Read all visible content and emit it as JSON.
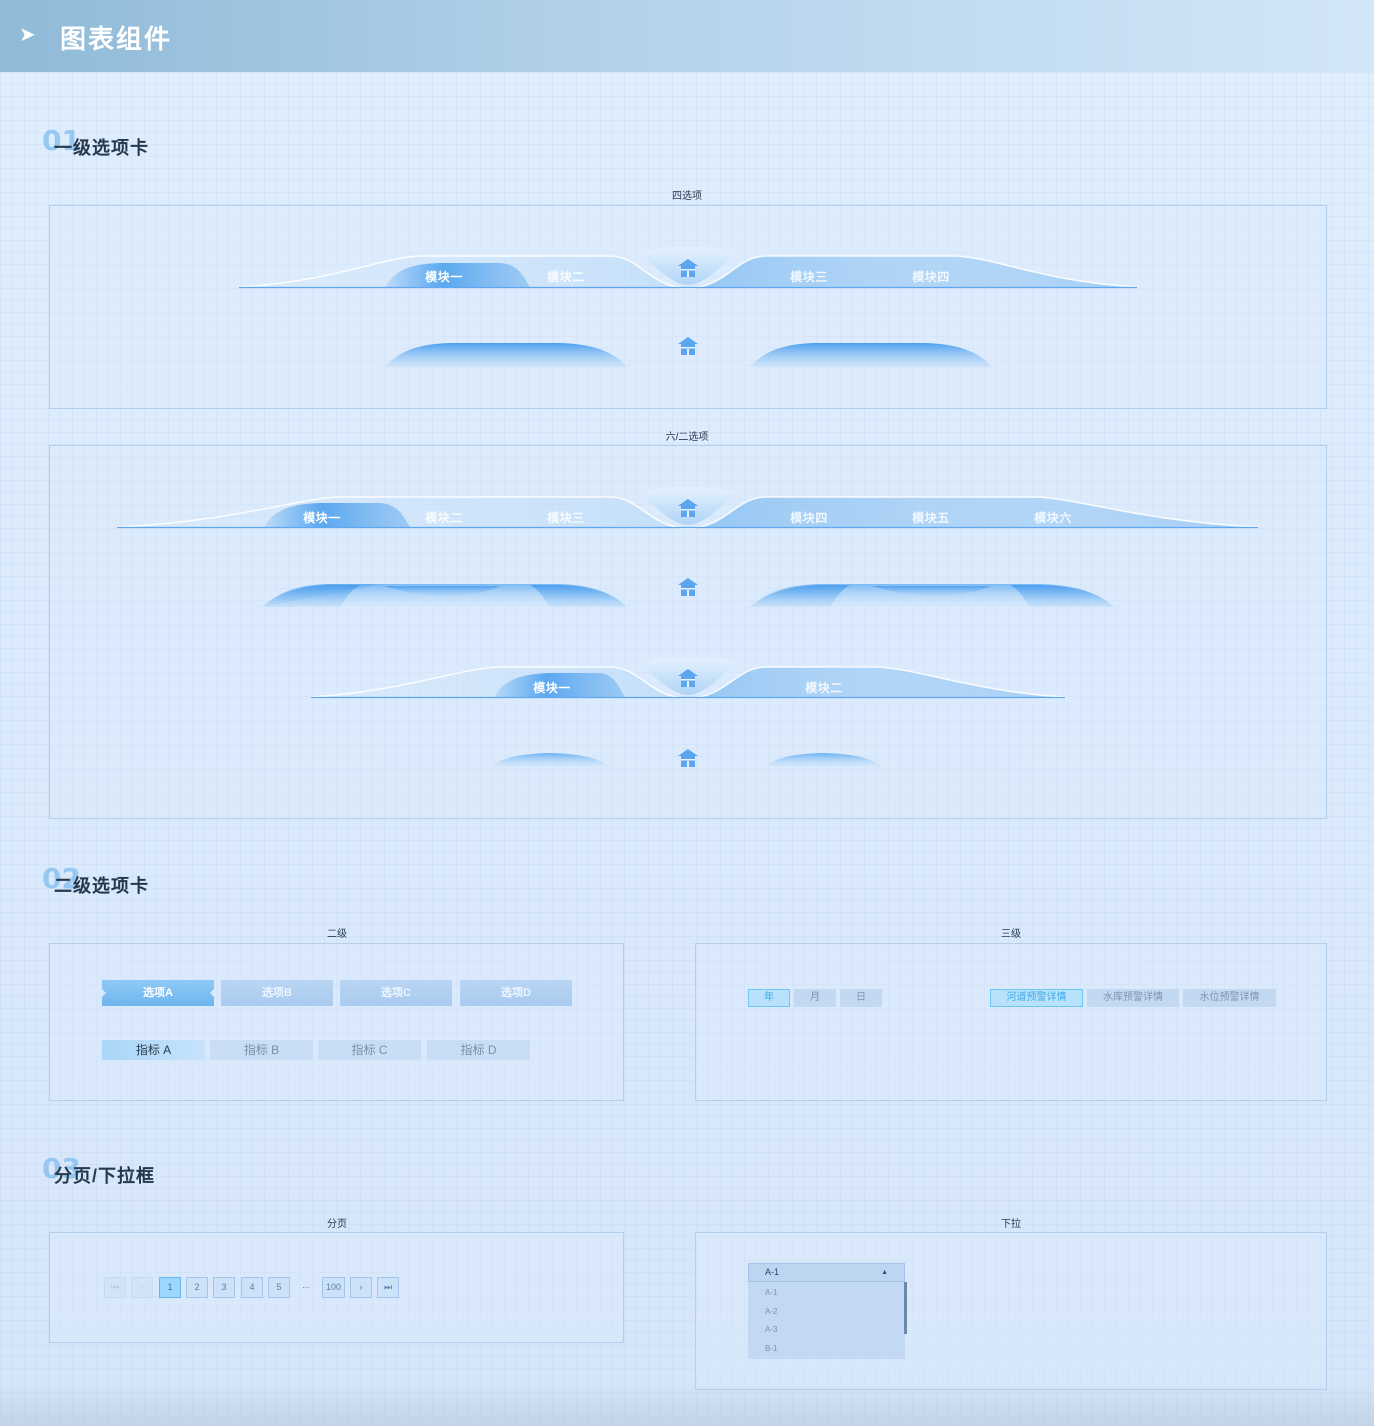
{
  "header": {
    "title": "图表组件"
  },
  "sections": {
    "s1": {
      "num": "01",
      "title": "一级选项卡"
    },
    "s2": {
      "num": "02",
      "title": "二级选项卡"
    },
    "s3": {
      "num": "03",
      "title": "分页/下拉框"
    }
  },
  "level1": {
    "four_caption": "四选项",
    "six_two_caption": "六/二选项",
    "four_tabs": [
      "模块一",
      "模块二",
      "模块三",
      "模块四"
    ],
    "six_tabs": [
      "模块一",
      "模块二",
      "模块三",
      "模块四",
      "模块五",
      "模块六"
    ],
    "two_tabs": [
      "模块一",
      "模块二"
    ]
  },
  "level2": {
    "caption": "二级",
    "tabs": [
      "选项A",
      "选项B",
      "选项C",
      "选项D"
    ],
    "indicators": [
      "指标 A",
      "指标 B",
      "指标 C",
      "指标 D"
    ]
  },
  "level3": {
    "caption": "三级",
    "time_tabs": [
      "年",
      "月",
      "日"
    ],
    "detail_tabs": [
      "河道预警详情",
      "水库预警详情",
      "水位预警详情"
    ]
  },
  "pagination": {
    "caption": "分页",
    "first": "⏮",
    "prev": "‹",
    "pages": [
      "1",
      "2",
      "3",
      "4",
      "5"
    ],
    "ellipsis": "...",
    "last_page": "100",
    "next": "›",
    "last": "⏭",
    "current": "1"
  },
  "dropdown": {
    "caption": "下拉",
    "selected": "A-1",
    "options": [
      "A-1",
      "A-2",
      "A-3",
      "B-1"
    ]
  },
  "colors": {
    "accent": "#6fb5ee",
    "tab_light": "#cfe6fb",
    "tab_dark": "#7bb6ef"
  }
}
